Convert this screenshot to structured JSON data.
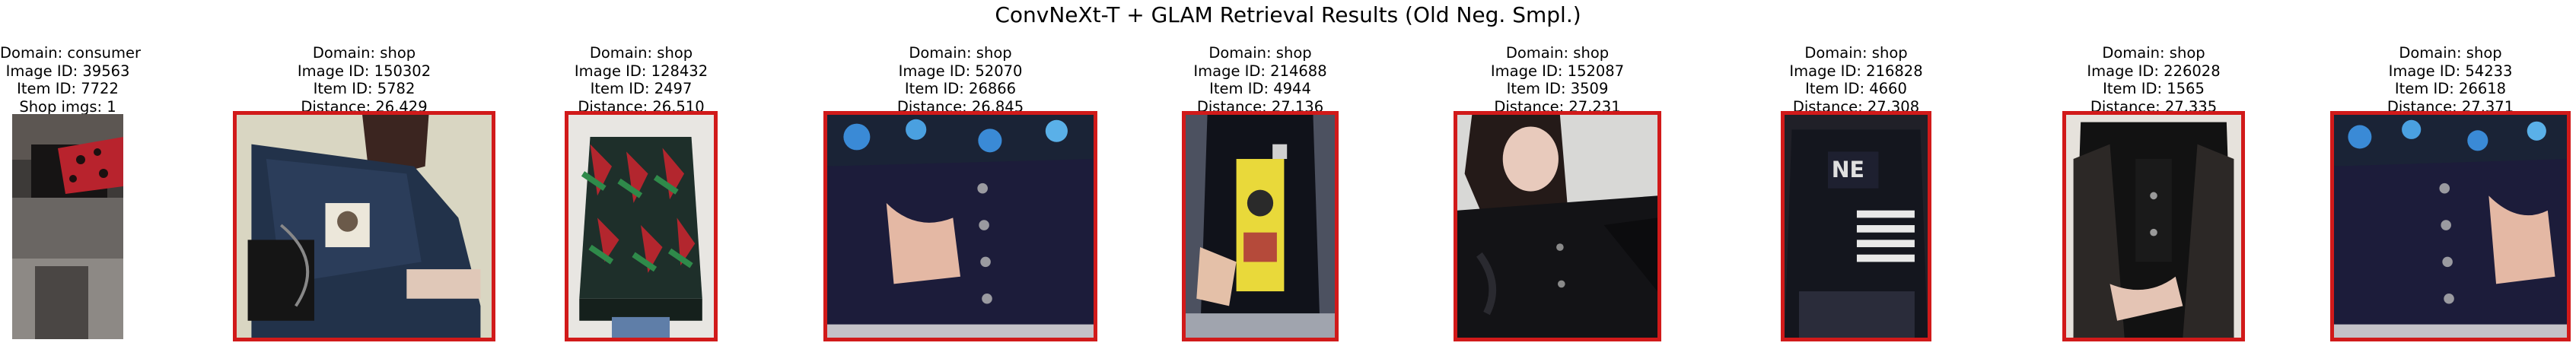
{
  "title": "ConvNeXt-T + GLAM Retrieval Results (Old Neg. Smpl.)",
  "colors": {
    "match_border": "#d11a1a",
    "background": "#ffffff"
  },
  "query": {
    "domain": "Domain: consumer",
    "image_id": "Image ID: 39563",
    "item_id": "Item ID: 7722",
    "shop_imgs": "Shop imgs: 1",
    "picture": "blurred dark photo of a person in a black top with a red patterned garment"
  },
  "results": [
    {
      "domain": "Domain: shop",
      "image_id": "Image ID: 150302",
      "item_id": "Item ID: 5782",
      "distance": "Distance: 26.429",
      "picture": "woman in cropped denim shirt with cat patch holding black bag"
    },
    {
      "domain": "Domain: shop",
      "image_id": "Image ID: 128432",
      "item_id": "Item ID: 2497",
      "distance": "Distance: 26.510",
      "picture": "green plaid jacket with red floral pattern over denim shorts"
    },
    {
      "domain": "Domain: shop",
      "image_id": "Image ID: 52070",
      "item_id": "Item ID: 26866",
      "distance": "Distance: 26.845",
      "picture": "close-up of dark denim skirt with buttons and floral top"
    },
    {
      "domain": "Domain: shop",
      "image_id": "Image ID: 214688",
      "item_id": "Item ID: 4944",
      "distance": "Distance: 27.136",
      "picture": "person in long black jacket over yellow graphic shirt"
    },
    {
      "domain": "Domain: shop",
      "image_id": "Image ID: 152087",
      "item_id": "Item ID: 3509",
      "distance": "Distance: 27.231",
      "picture": "woman with long hair in black button jacket"
    },
    {
      "domain": "Domain: shop",
      "image_id": "Image ID: 216828",
      "item_id": "Item ID: 4660",
      "distance": "Distance: 27.308",
      "picture": "black jacket with white letters and striped sleeves"
    },
    {
      "domain": "Domain: shop",
      "image_id": "Image ID: 226028",
      "item_id": "Item ID: 1565",
      "distance": "Distance: 27.335",
      "picture": "black baseball jacket with leather sleeves"
    },
    {
      "domain": "Domain: shop",
      "image_id": "Image ID: 54233",
      "item_id": "Item ID: 26618",
      "distance": "Distance: 27.371",
      "picture": "close-up of dark denim skirt with buttons and floral top"
    }
  ]
}
